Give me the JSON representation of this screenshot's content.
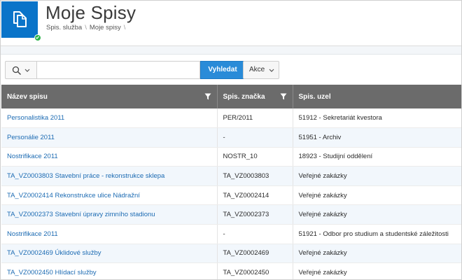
{
  "header": {
    "title": "Moje Spisy",
    "breadcrumb": [
      "Spis. služba",
      "Moje spisy"
    ],
    "app_icon": "documents-icon",
    "status_icon": "check-icon",
    "accent_color": "#0a74c9",
    "status_color": "#2cb34a"
  },
  "toolbar": {
    "search_selector_icon": "search-icon",
    "search_value": "",
    "search_button_label": "Vyhledat",
    "actions_label": "Akce",
    "button_color": "#2a8bd8"
  },
  "table": {
    "columns": [
      {
        "label": "Název spisu",
        "filter": true
      },
      {
        "label": "Spis. značka",
        "filter": true
      },
      {
        "label": "Spis. uzel",
        "filter": false
      }
    ],
    "rows": [
      {
        "name": "Personalistika 2011",
        "mark": "PER/2011",
        "node": "51912 - Sekretariát kvestora"
      },
      {
        "name": "Personálie 2011",
        "mark": "-",
        "node": "51951 - Archiv"
      },
      {
        "name": "Nostrifikace 2011",
        "mark": "NOSTR_10",
        "node": "18923 - Studijní oddělení"
      },
      {
        "name": "TA_VZ0003803 Stavební práce - rekonstrukce sklepa",
        "mark": "TA_VZ0003803",
        "node": "Veřejné zakázky"
      },
      {
        "name": "TA_VZ0002414 Rekonstrukce ulice Nádražní",
        "mark": "TA_VZ0002414",
        "node": "Veřejné zakázky"
      },
      {
        "name": "TA_VZ0002373 Stavební úpravy zimního stadionu",
        "mark": "TA_VZ0002373",
        "node": "Veřejné zakázky"
      },
      {
        "name": "Nostrifikace 2011",
        "mark": "-",
        "node": "51921 - Odbor pro studium a studentské záležitosti"
      },
      {
        "name": "TA_VZ0002469 Úklidové služby",
        "mark": "TA_VZ0002469",
        "node": "Veřejné zakázky"
      },
      {
        "name": "TA_VZ0002450 Hlídací služby",
        "mark": "TA_VZ0002450",
        "node": "Veřejné zakázky"
      }
    ]
  }
}
